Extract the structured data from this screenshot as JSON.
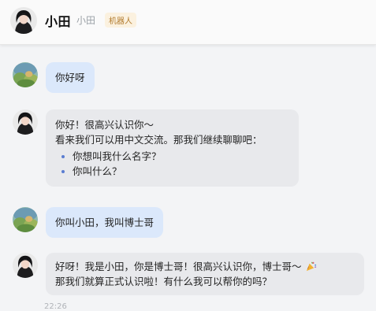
{
  "header": {
    "name": "小田",
    "subname": "小田",
    "badge": "机器人"
  },
  "messages": [
    {
      "from": "user",
      "text": "你好呀"
    },
    {
      "from": "bot",
      "line1": "你好！很高兴认识你～",
      "line2": "看来我们可以用中文交流。那我们继续聊聊吧：",
      "items": [
        "你想叫我什么名字？",
        "你叫什么？"
      ]
    },
    {
      "from": "user",
      "text": "你叫小田，我叫博士哥"
    },
    {
      "from": "bot",
      "line1": "好呀！我是小田，你是博士哥！很高兴认识你，博士哥～",
      "emoji": "party-popper-icon",
      "line2": "那我们就算正式认识啦！有什么我可以帮你的吗？"
    }
  ],
  "timestamp": "22:26",
  "colors": {
    "user_bubble": "#dbe8fb",
    "bot_bubble": "#e8e9ec",
    "badge_text": "#b27b2d",
    "badge_bg": "#fbf1df"
  }
}
